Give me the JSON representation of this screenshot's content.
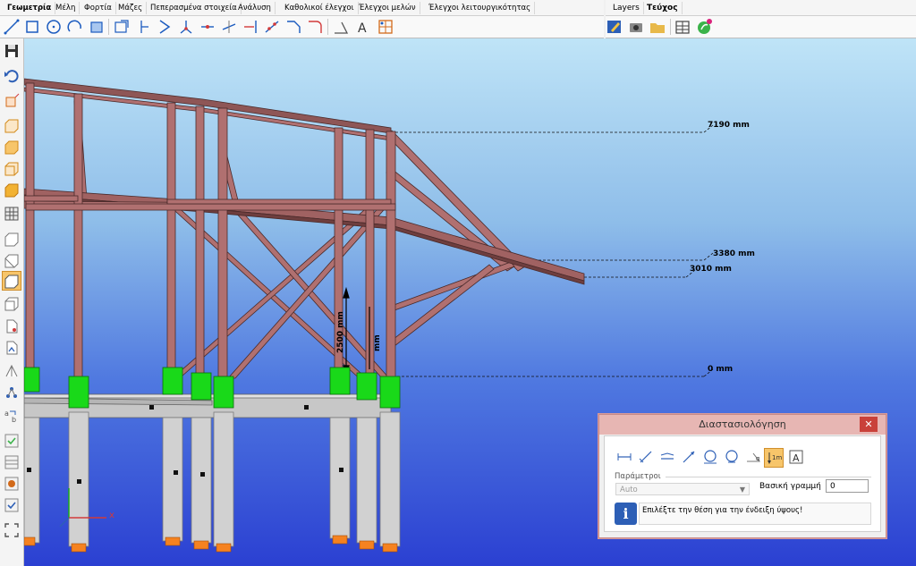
{
  "menu": {
    "tabs": [
      "Γεωμετρία",
      "Μέλη",
      "Φορτία",
      "Μάζες",
      "Πεπερασμένα στοιχεία",
      "Ανάλυση",
      "Καθολικοί έλεγχοι",
      "Έλεγχοι μελών",
      "Έλεγχοι λειτουργικότητας"
    ],
    "right_tabs": [
      "Layers",
      "Τεύχος"
    ]
  },
  "toolbar": {
    "icons": [
      "line-tool",
      "rectangle-tool",
      "circle-tool",
      "arc-tool",
      "polygon-tool",
      "view-box",
      "node-tool",
      "arrow-tool",
      "member-split",
      "break-tool",
      "trim-tool",
      "extend-tool",
      "fillet-tool",
      "chamfer-tool",
      "angle-tool",
      "text-tool",
      "grid-tool"
    ],
    "right_icons": [
      "edit-icon",
      "camera-icon",
      "folder-icon",
      "building-icon",
      "leaf-icon"
    ]
  },
  "viewport": {
    "dimensions": [
      {
        "label": "7190 mm"
      },
      {
        "label": "3380 mm"
      },
      {
        "label": "3010 mm"
      },
      {
        "label": "0 mm"
      }
    ],
    "vertical_dims": [
      "2500 mm",
      "mm"
    ],
    "axis": {
      "x": "x"
    }
  },
  "dialog": {
    "title": "Διαστασιολόγηση",
    "close": "✕",
    "params_label": "Παράμετροι",
    "mode_value": "Auto",
    "baseline_label": "Βασική γραμμή",
    "baseline_value": "0",
    "info_icon": "i",
    "info_text": "Επιλέξτε την θέση για την ένδειξη ύψους!",
    "tool_labels": {
      "height": "1m",
      "text": "A"
    }
  },
  "colors": {
    "steel": "#b07070",
    "support": "#19d919",
    "pile": "#d1d1d1",
    "base": "#f58220",
    "selection": "#f7c56a"
  }
}
